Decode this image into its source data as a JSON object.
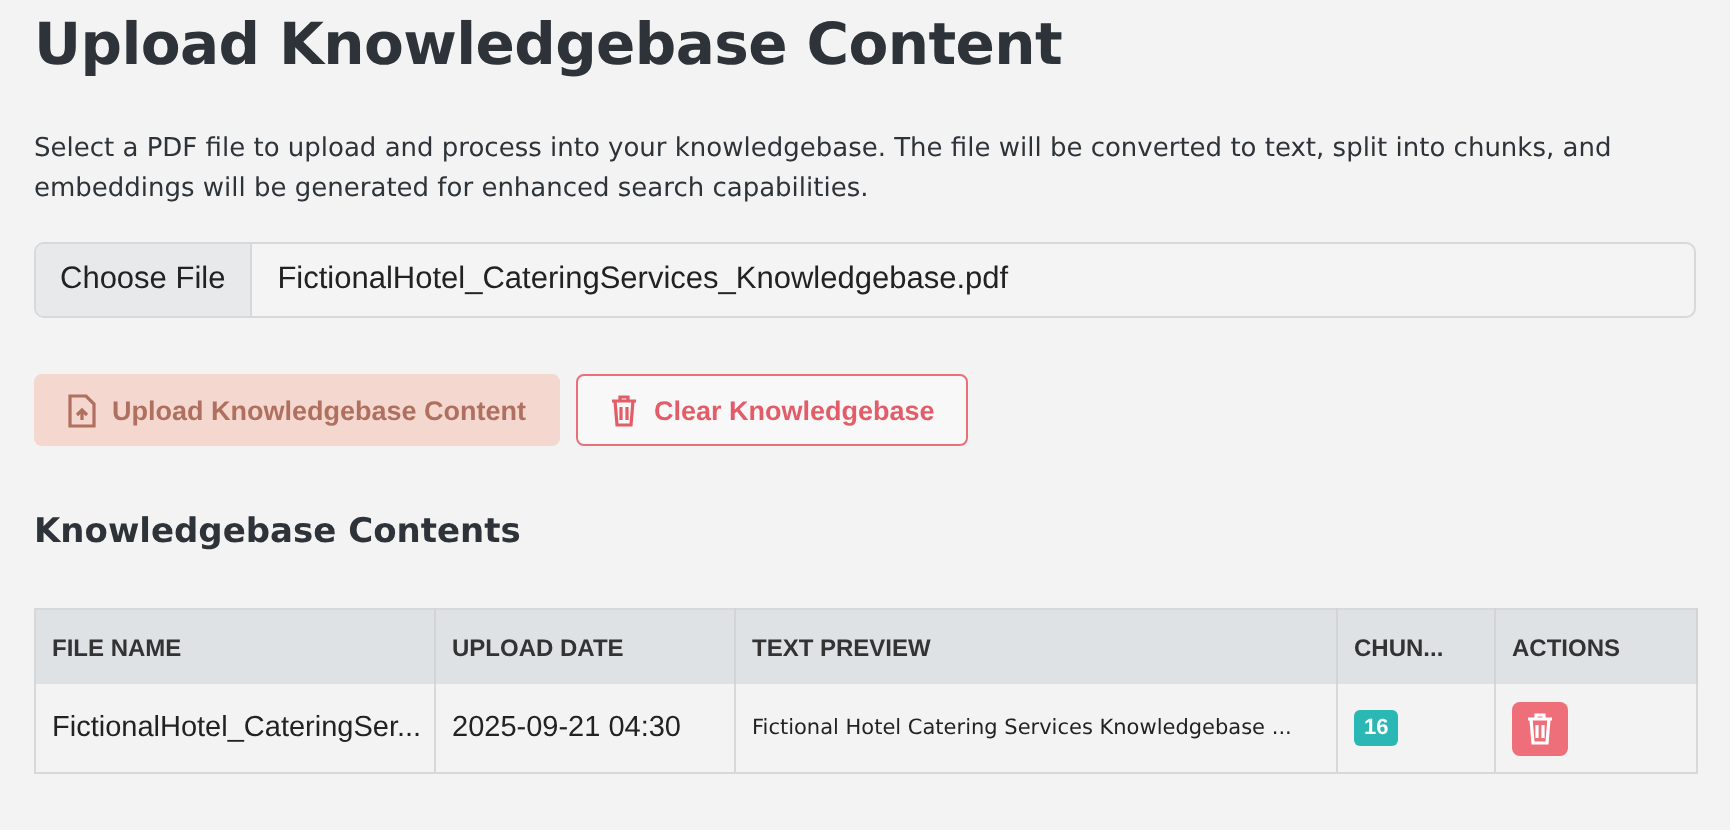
{
  "title": "Upload Knowledgebase Content",
  "description": "Select a PDF file to upload and process into your knowledgebase. The file will be converted to text, split into chunks, and embeddings will be generated for enhanced search capabilities.",
  "file_input": {
    "button": "Choose File",
    "value": "FictionalHotel_CateringServices_Knowledgebase.pdf"
  },
  "buttons": [
    {
      "kind": "upload",
      "label": "Upload Knowledgebase Content",
      "disabled": true
    },
    {
      "kind": "clear",
      "label": "Clear Knowledgebase",
      "disabled": false
    }
  ],
  "section_title": "Knowledgebase Contents",
  "table": {
    "columns": [
      "FILE NAME",
      "UPLOAD DATE",
      "TEXT PREVIEW",
      "CHUN...",
      "ACTIONS"
    ],
    "rows": [
      {
        "file_name": "FictionalHotel_CateringSer...",
        "upload_date": "2025-09-21 04:30",
        "text_preview": "Fictional Hotel Catering Services Knowledgebase ...",
        "chunks": "16"
      }
    ]
  }
}
